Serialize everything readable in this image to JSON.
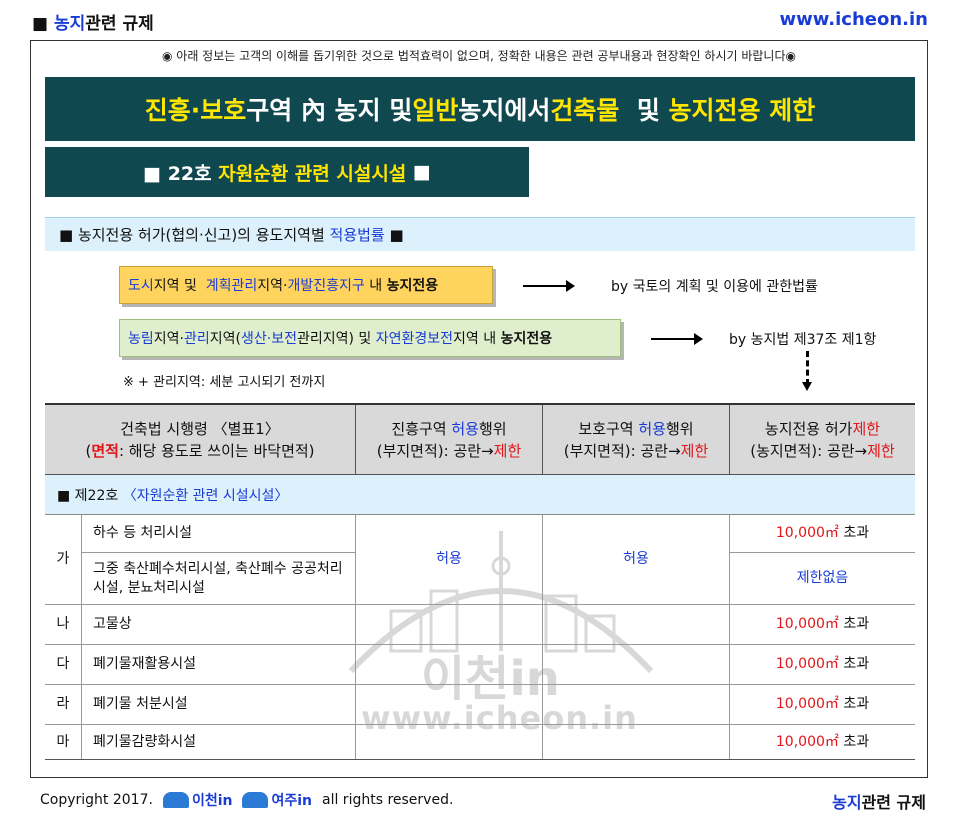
{
  "header": {
    "left_prefix": "■ ",
    "left_highlight": "농지",
    "left_rest": "관련 규제",
    "site": "www.icheon.in"
  },
  "notice": "◉ 아래 정보는 고객의 이해를 돕기위한 것으로 법적효력이 없으며, 정확한 내용은 관련 공부내용과 현장확인 하시기 바랍니다◉",
  "title": {
    "p1": "진흥·보호",
    "p2": "구역 內 농지 및 ",
    "p3": "일반",
    "p4": "농지에서 ",
    "p5": "건축물",
    "p6": "  및 ",
    "p7": "농지전용 제한"
  },
  "subtitle": {
    "prefix": "■ 22호 ",
    "highlight": "자원순환 관련 시설시설",
    "suffix": " ■"
  },
  "law_heading": {
    "prefix": "■ 농지전용 허가(협의·신고)의 용도지역별 ",
    "highlight": "적용법률",
    "suffix": " ■"
  },
  "box1": {
    "a": "도시",
    "b": "지역 및  ",
    "c": "계획관리",
    "d": "지역·",
    "e": "개발진흥지구",
    "f": " 내 ",
    "g": "농지전용"
  },
  "box2": {
    "a": "농림",
    "b": "지역·",
    "c": "관리",
    "d": "지역(",
    "e": "생산·보전",
    "f": "관리지역) 및 ",
    "g": "자연환경보전",
    "h": "지역 내 ",
    "i": "농지전용"
  },
  "law1": "by 국토의 계획 및 이용에 관한법률",
  "law2": "by 농지법 제37조 제1항",
  "footnote": "※ + 관리지역: 세분 고시되기 전까지",
  "table": {
    "col1": {
      "line1": "건축법 시행령 〈별표1〉",
      "l2_open": "(",
      "l2_red": "면적",
      "l2_rest": ": 해당 용도로 쓰이는 바닥면적)"
    },
    "col2": {
      "l1a": "진흥구역 ",
      "l1b": "허용",
      "l1c": "행위",
      "l2a": "(부지면적): 공란→",
      "l2b": "제한"
    },
    "col3": {
      "l1a": "보호구역 ",
      "l1b": "허용",
      "l1c": "행위",
      "l2a": "(부지면적): 공란→",
      "l2b": "제한"
    },
    "col4": {
      "l1a": "농지전용 허가",
      "l1b": "제한",
      "l2a": "(농지면적): 공란→",
      "l2b": "제한"
    },
    "section": {
      "prefix": "■ 제22호 ",
      "highlight": "〈자원순환 관련 시설시설〉"
    },
    "rows": [
      {
        "label": "가",
        "item": "하수 등 처리시설",
        "limit": "10,000㎡",
        "suffix": " 초과"
      },
      {
        "item": "그중 축산폐수처리시설, 축산폐수 공공처리시설, 분뇨처리시설",
        "limit": "제한없음"
      },
      {
        "label": "나",
        "item": "고물상",
        "limit": "10,000㎡",
        "suffix": " 초과"
      },
      {
        "label": "다",
        "item": "폐기물재활용시설",
        "limit": "10,000㎡",
        "suffix": " 초과"
      },
      {
        "label": "라",
        "item": "폐기물 처분시설",
        "limit": "10,000㎡",
        "suffix": " 초과"
      },
      {
        "label": "마",
        "item": "폐기물감량화시설",
        "limit": "10,000㎡",
        "suffix": " 초과"
      }
    ],
    "allowed_jinheung": "허용",
    "allowed_boho": "허용"
  },
  "watermark": {
    "text1": "이천in",
    "text2": "www.icheon.in"
  },
  "footer": {
    "copyright": "Copyright 2017.",
    "logo1": "이천in",
    "logo2": "여주in",
    "rights": "all rights reserved.",
    "right_highlight": "농지",
    "right_rest": "관련 규제"
  },
  "colors": {
    "title_bg": "#104850",
    "highlight_yellow": "#ffe600",
    "blue": "#1a3cd6",
    "red": "#e0161b",
    "box1_bg": "#ffd45e",
    "box2_bg": "#dfefcd",
    "light_blue_bg": "#dcf1fb"
  }
}
